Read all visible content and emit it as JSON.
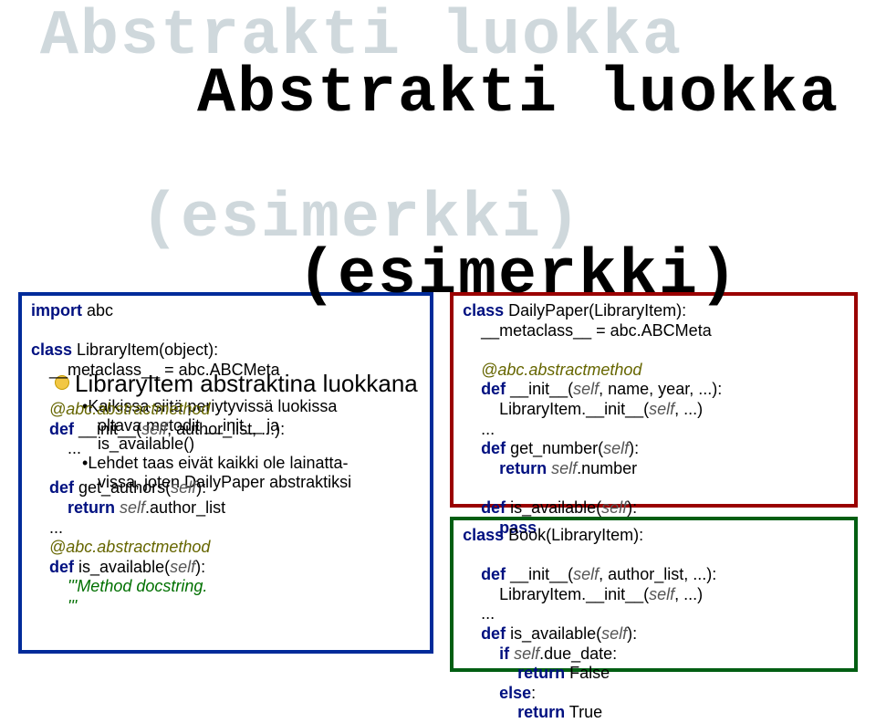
{
  "title_line1": "Abstrakti luokka",
  "title_line2": "(esimerkki)",
  "bullet_text": "LibraryItem abstraktina luokkana",
  "desc1a": "Kaikissa siitä periytyvissä luokissa",
  "desc1b": "oltava metodit __init__ ja",
  "desc1c": "is_available()",
  "desc2a": "Lehdet taas eivät kaikki ole lainatta-",
  "desc2b": "vissa, joten DailyPaper abstraktiksi",
  "left": {
    "l1a": "import",
    "l1b": " abc",
    "l2a": "class",
    "l2b": " LibraryItem(object):",
    "l3": "    __metaclass__ = abc.ABCMeta",
    "l4": "    @abc.abstractmethod",
    "l5a": "    def",
    "l5b": " __init__(",
    "l5c": "self",
    "l5d": ", author_list, ...):",
    "l6": "        ...",
    "l7a": "    def",
    "l7b": " get_authors(",
    "l7c": "self",
    "l7d": "):",
    "l8a": "        return",
    "l8b": " ",
    "l8c": "self",
    "l8d": ".author_list",
    "l9": "    ...",
    "l10": "    @abc.abstractmethod",
    "l11a": "    def",
    "l11b": " is_available(",
    "l11c": "self",
    "l11d": "):",
    "l12": "        '''Method docstring.",
    "l13": "        '''"
  },
  "rtop": {
    "l1a": "class",
    "l1b": " DailyPaper(LibraryItem):",
    "l2": "    __metaclass__ = abc.ABCMeta",
    "l3": "    @abc.abstractmethod",
    "l4a": "    def",
    "l4b": " __init__(",
    "l4c": "self",
    "l4d": ", name, year, ...):",
    "l5": "        LibraryItem.__init__(",
    "l5b": "self",
    "l5c": ", ...)",
    "l6": "    ...",
    "l7a": "    def",
    "l7b": " get_number(",
    "l7c": "self",
    "l7d": "):",
    "l8a": "        return",
    "l8b": " ",
    "l8c": "self",
    "l8d": ".number",
    "l9a": "    def",
    "l9b": " is_available(",
    "l9c": "self",
    "l9d": "):",
    "l10a": "        pass"
  },
  "rbot": {
    "l1a": "class",
    "l1b": " Book(LibraryItem):",
    "l2a": "    def",
    "l2b": " __init__(",
    "l2c": "self",
    "l2d": ", author_list, ...):",
    "l3": "        LibraryItem.__init__(",
    "l3b": "self",
    "l3c": ", ...)",
    "l4": "    ...",
    "l5a": "    def",
    "l5b": " is_available(",
    "l5c": "self",
    "l5d": "):",
    "l6a": "        if",
    "l6b": " ",
    "l6c": "self",
    "l6d": ".due_date:",
    "l7a": "            return",
    "l7b": " False",
    "l8a": "        else",
    "l8b": ":",
    "l9a": "            return",
    "l9b": " True"
  }
}
